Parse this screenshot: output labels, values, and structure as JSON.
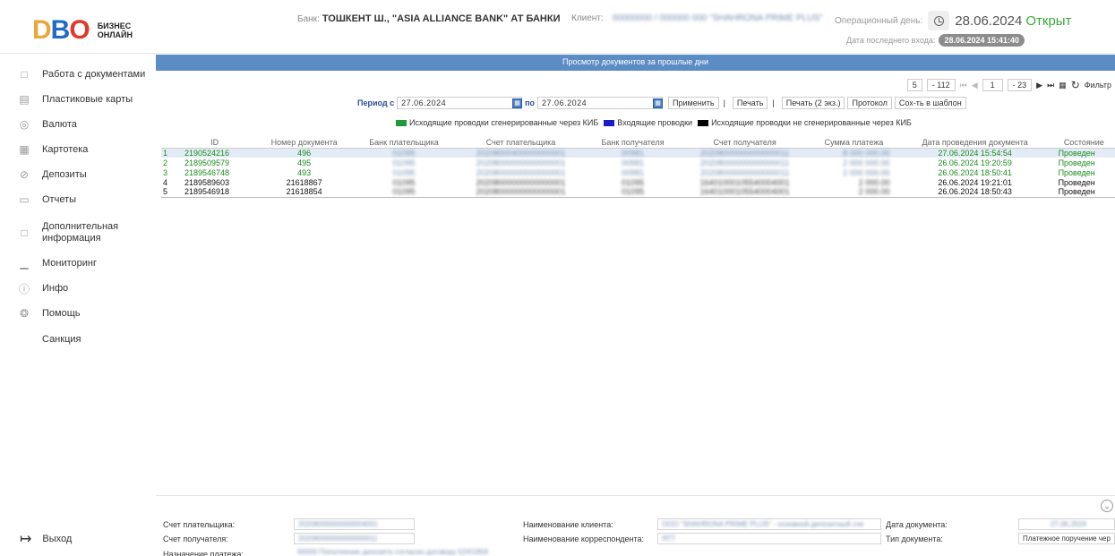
{
  "header": {
    "logo_mark": "DBO",
    "logo_text_1": "БИЗНЕС",
    "logo_text_2": "ОНЛАЙН",
    "bank_label": "Банк:",
    "bank_name": "ТОШКЕНТ Ш., \"ASIA ALLIANCE BANK\" АТ БАНКИ",
    "client_label": "Клиент:",
    "client_name": "00000000 / 000000 000 \"SHAHRONA PRIME PLUS\"",
    "opday_label": "Операционный день:",
    "opday_date": "28.06.2024",
    "opday_status": "Открыт",
    "last_login_label": "Дата последнего входа:",
    "last_login_value": "28.06.2024 15:41:40"
  },
  "sidebar": {
    "items": [
      {
        "label": "Работа с документами",
        "icon": "documents-icon"
      },
      {
        "label": "Пластиковые карты",
        "icon": "card-icon"
      },
      {
        "label": "Валюта",
        "icon": "currency-icon"
      },
      {
        "label": "Картотека",
        "icon": "cabinet-icon"
      },
      {
        "label": "Депозиты",
        "icon": "percent-icon"
      },
      {
        "label": "Отчеты",
        "icon": "report-icon"
      },
      {
        "label": "Дополнительная информация",
        "icon": "info-bubble-icon"
      },
      {
        "label": "Мониторинг",
        "icon": "monitor-chart-icon"
      },
      {
        "label": "Инфо",
        "icon": "info-icon"
      },
      {
        "label": "Помощь",
        "icon": "help-icon"
      },
      {
        "label": "Санкция",
        "icon": ""
      }
    ],
    "logout_label": "Выход"
  },
  "panel": {
    "title": "Просмотр документов за прошлые дни",
    "pager": {
      "page_size": "5",
      "total": "- 112",
      "page": "1",
      "pages": "- 23",
      "filter_label": "Фильтр"
    },
    "period": {
      "from_label": "Период с",
      "from_value": "27.06.2024",
      "to_label": "по",
      "to_value": "27.06.2024",
      "apply_label": "Применить",
      "print_label": "Печать",
      "print2_label": "Печать (2 экз.)",
      "protocol_label": "Протокол",
      "save_template_label": "Сох-ть в шаблон"
    },
    "legend": [
      {
        "label": "Исходящие проводки сгенерированные через КИБ",
        "color": "#1e9a3a"
      },
      {
        "label": "Входящие проводки",
        "color": "#1a1ac8"
      },
      {
        "label": "Исходящие проводки не сгенерированные через КИБ",
        "color": "#000000"
      }
    ],
    "columns": [
      "ID",
      "Номер документа",
      "Банк плательщика",
      "Счет плательщика",
      "Банк получателя",
      "Счет получателя",
      "Сумма платежа",
      "Дата проведения документа",
      "Состояние"
    ],
    "rows": [
      {
        "n": "1",
        "id": "2190524216",
        "doc": "496",
        "payer_bank": "01095",
        "payer_acc": "20208000400000000001",
        "rcpt_bank": "00981",
        "rcpt_acc": "20208000000000000011",
        "amount": "8 000 000.00",
        "date": "27.06.2024 15:54:54",
        "state": "Проведен",
        "kind": "g",
        "selected": true
      },
      {
        "n": "2",
        "id": "2189509579",
        "doc": "495",
        "payer_bank": "01095",
        "payer_acc": "20208000000000000001",
        "rcpt_bank": "00981",
        "rcpt_acc": "20208000000000000011",
        "amount": "2 000 000.00",
        "date": "26.06.2024 19:20:59",
        "state": "Проведен",
        "kind": "g",
        "selected": false
      },
      {
        "n": "3",
        "id": "2189546748",
        "doc": "493",
        "payer_bank": "01095",
        "payer_acc": "20208000000000000001",
        "rcpt_bank": "00981",
        "rcpt_acc": "20208000000000000011",
        "amount": "2 000 000.00",
        "date": "26.06.2024 18:50:41",
        "state": "Проведен",
        "kind": "g",
        "selected": false
      },
      {
        "n": "4",
        "id": "2189589603",
        "doc": "21618867",
        "payer_bank": "01095",
        "payer_acc": "20208000000000000001",
        "rcpt_bank": "01095",
        "rcpt_acc": "16401000105540004001",
        "amount": "2 000.00",
        "date": "26.06.2024 19:21:01",
        "state": "Проведен",
        "kind": "k",
        "selected": false
      },
      {
        "n": "5",
        "id": "2189546918",
        "doc": "21618854",
        "payer_bank": "01095",
        "payer_acc": "20208000000000000001",
        "rcpt_bank": "01095",
        "rcpt_acc": "16401000105540004001",
        "amount": "2 000.00",
        "date": "26.06.2024 18:50:43",
        "state": "Проведен",
        "kind": "k",
        "selected": false
      }
    ]
  },
  "details": {
    "payer_acc_label": "Счет плательщика:",
    "payer_acc_value": "20208000000000004001",
    "rcpt_acc_label": "Счет получателя:",
    "rcpt_acc_value": "20208000000000000011",
    "purpose_label": "Назначение платежа:",
    "purpose_value": "00000 Пополнение депозита согласно договору 52/01858",
    "client_name_label": "Наименование клиента:",
    "client_name_value": "ООО \"SHAHRONA PRIME PLUS\" - основной депозитный сче",
    "corr_name_label": "Наименование корреспондента:",
    "corr_name_value": "ЯТТ",
    "doc_date_label": "Дата документа:",
    "doc_date_value": "27.06.2024",
    "doc_type_label": "Тип документа:",
    "doc_type_value": "Платежное поручение чер"
  }
}
